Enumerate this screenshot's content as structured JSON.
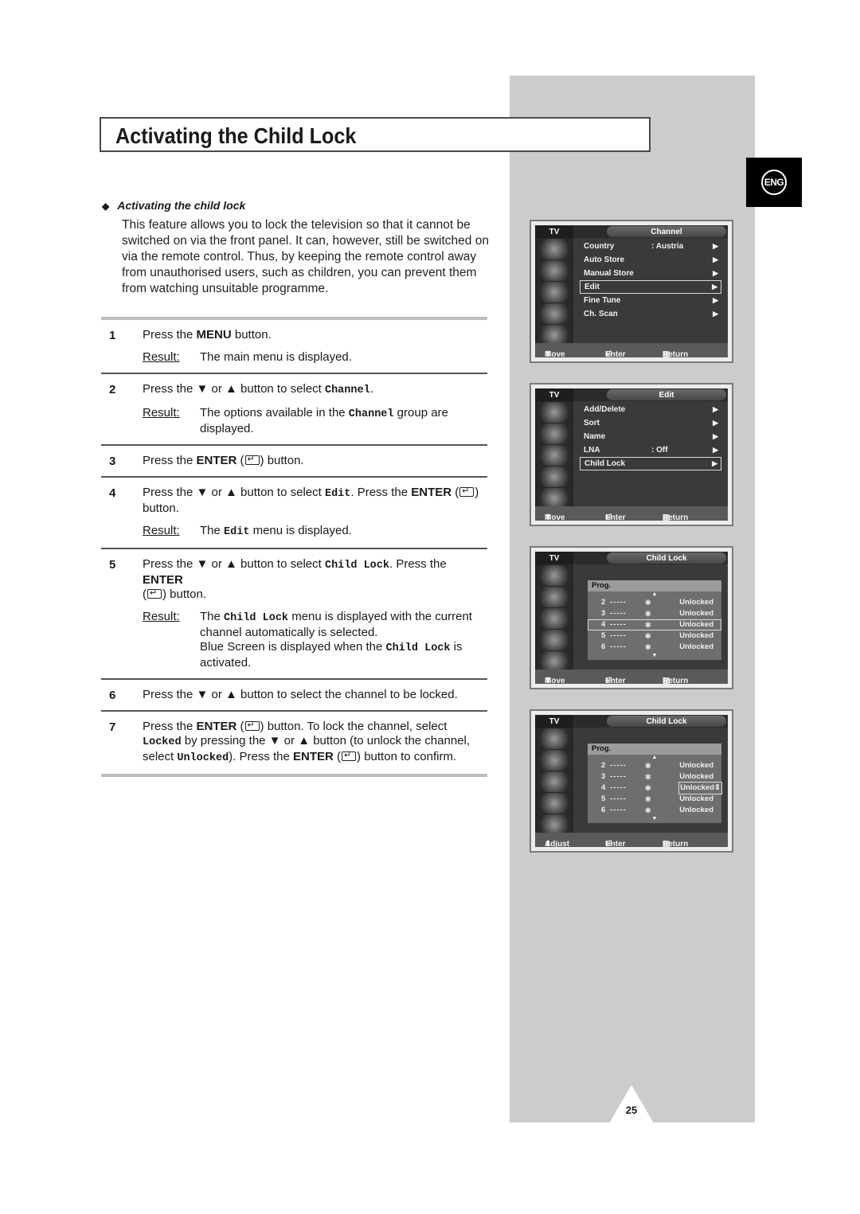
{
  "page": {
    "title": "Activating the Child Lock",
    "language_badge": "ENG",
    "page_number": "25"
  },
  "section": {
    "heading": "Activating the child lock",
    "intro": "This feature allows you to lock the television so that it cannot be switched on via the front panel. It can, however, still be switched on via the remote control. Thus, by keeping the remote control away from unauthorised users, such as children, you can prevent them from watching unsuitable programme."
  },
  "labels": {
    "result": "Result:",
    "down_arrow": "▼",
    "up_arrow": "▲"
  },
  "steps": [
    {
      "num": "1",
      "parts": [
        "Press the ",
        "MENU",
        " button."
      ],
      "result": "The main menu is displayed."
    },
    {
      "num": "2",
      "parts": [
        "Press the ▼ or ▲ button to select ",
        "Channel",
        "."
      ],
      "result_parts": [
        "The options available in the ",
        "Channel",
        " group are displayed."
      ]
    },
    {
      "num": "3",
      "parts": [
        "Press the ",
        "ENTER",
        " (",
        ") button."
      ]
    },
    {
      "num": "4",
      "parts": [
        "Press the ▼ or ▲ button to select ",
        "Edit",
        ". Press the ",
        "ENTER",
        " (",
        ") button."
      ],
      "result_parts": [
        "The ",
        "Edit",
        " menu is displayed."
      ]
    },
    {
      "num": "5",
      "parts": [
        "Press the ▼ or ▲ button to select ",
        "Child Lock",
        ". Press the ",
        "ENTER",
        " (",
        ") button."
      ],
      "result_parts": [
        "The ",
        "Child Lock",
        " menu is displayed with the current channel automatically is selected."
      ],
      "result_extra_parts": [
        "Blue Screen is displayed when the ",
        "Child Lock",
        " is activated."
      ]
    },
    {
      "num": "6",
      "parts": [
        "Press the ▼ or ▲ button to select the channel to be locked."
      ]
    },
    {
      "num": "7",
      "parts": [
        "Press the ",
        "ENTER",
        " (",
        ") button. To lock the channel, select ",
        "Locked",
        " by pressing the ▼ or ▲ button (to unlock the channel, select ",
        "Unlocked",
        "). Press the ",
        "ENTER",
        " (",
        ") button to confirm."
      ]
    }
  ],
  "screens": [
    {
      "tv_label": "TV",
      "title": "Channel",
      "items": [
        {
          "label": "Country",
          "value": ": Austria",
          "arrow": "▶"
        },
        {
          "label": "Auto Store",
          "value": "",
          "arrow": "▶"
        },
        {
          "label": "Manual Store",
          "value": "",
          "arrow": "▶"
        },
        {
          "label": "Edit",
          "value": "",
          "arrow": "▶",
          "selected": true
        },
        {
          "label": "Fine Tune",
          "value": "",
          "arrow": "▶"
        },
        {
          "label": "Ch. Scan",
          "value": "",
          "arrow": "▶"
        }
      ],
      "footer": {
        "nav": "Move",
        "enter": "Enter",
        "return": "Return"
      }
    },
    {
      "tv_label": "TV",
      "title": "Edit",
      "items": [
        {
          "label": "Add/Delete",
          "value": "",
          "arrow": "▶"
        },
        {
          "label": "Sort",
          "value": "",
          "arrow": "▶"
        },
        {
          "label": "Name",
          "value": "",
          "arrow": "▶"
        },
        {
          "label": "LNA",
          "value": ": Off",
          "arrow": "▶"
        },
        {
          "label": "Child Lock",
          "value": "",
          "arrow": "▶",
          "selected": true
        }
      ],
      "footer": {
        "nav": "Move",
        "enter": "Enter",
        "return": "Return"
      }
    },
    {
      "tv_label": "TV",
      "title": "Child Lock",
      "list_header": "Prog.",
      "rows": [
        {
          "prog": "2",
          "name": "-----",
          "mark": "✻",
          "status": "Unlocked"
        },
        {
          "prog": "3",
          "name": "-----",
          "mark": "✻",
          "status": "Unlocked"
        },
        {
          "prog": "4",
          "name": "-----",
          "mark": "✻",
          "status": "Unlocked",
          "selected": "row"
        },
        {
          "prog": "5",
          "name": "-----",
          "mark": "✻",
          "status": "Unlocked"
        },
        {
          "prog": "6",
          "name": "-----",
          "mark": "✻",
          "status": "Unlocked"
        }
      ],
      "footer": {
        "nav": "Move",
        "enter": "Enter",
        "return": "Return"
      }
    },
    {
      "tv_label": "TV",
      "title": "Child Lock",
      "list_header": "Prog.",
      "rows": [
        {
          "prog": "2",
          "name": "-----",
          "mark": "✻",
          "status": "Unlocked"
        },
        {
          "prog": "3",
          "name": "-----",
          "mark": "✻",
          "status": "Unlocked"
        },
        {
          "prog": "4",
          "name": "-----",
          "mark": "✻",
          "status": "Unlocked⇕",
          "selected": "value"
        },
        {
          "prog": "5",
          "name": "-----",
          "mark": "✻",
          "status": "Unlocked"
        },
        {
          "prog": "6",
          "name": "-----",
          "mark": "✻",
          "status": "Unlocked"
        }
      ],
      "footer": {
        "nav": "Adjust",
        "enter": "Enter",
        "return": "Return"
      }
    }
  ]
}
